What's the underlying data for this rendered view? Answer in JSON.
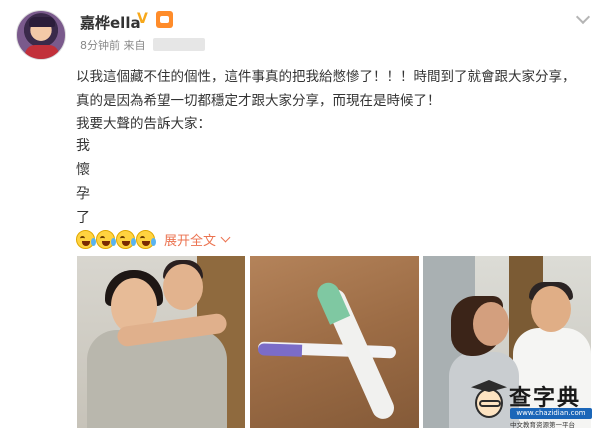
{
  "post": {
    "username": "嘉桦ella",
    "verified_mark": "V",
    "time": "8分钟前",
    "source_prefix": "来自",
    "text_lines": [
      "以我這個藏不住的個性，這件事真的把我給憋慘了！！！時間到了就會跟大家分享，真的是因為希望一切都穩定才跟大家分享，而現在是時候了！",
      "我要大聲的告訴大家："
    ],
    "vertical_chars": [
      "我",
      "懷",
      "孕",
      "了"
    ],
    "emoji_name": "cry-laugh-emoji",
    "emoji_count": 4,
    "expand_label": "展开全文"
  },
  "photos": [
    {
      "name": "couple-hug-photo"
    },
    {
      "name": "pregnancy-tests-photo"
    },
    {
      "name": "couple-mirror-photo"
    }
  ],
  "watermark": {
    "title": "查字典",
    "url": "www.chazidian.com",
    "subtitle": "中文教育资源第一平台"
  },
  "colors": {
    "accent": "#eb7350",
    "verified": "#f7a81b",
    "text": "#333333",
    "meta": "#888888"
  }
}
